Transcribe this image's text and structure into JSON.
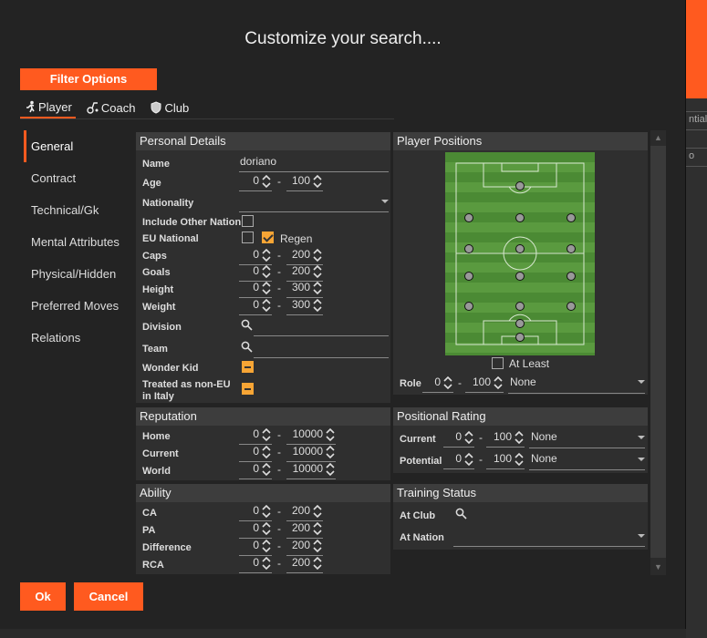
{
  "background": {
    "right_texts": [
      "ntial",
      "o"
    ]
  },
  "dialog": {
    "title": "Customize your search....",
    "filter_options_label": "Filter Options",
    "tabs": [
      {
        "label": "Player",
        "icon": "player-icon"
      },
      {
        "label": "Coach",
        "icon": "coach-icon"
      },
      {
        "label": "Club",
        "icon": "shield-icon"
      }
    ],
    "nav_items": [
      "General",
      "Contract",
      "Technical/Gk",
      "Mental Attributes",
      "Physical/Hidden",
      "Preferred Moves",
      "Relations"
    ],
    "ok_label": "Ok",
    "cancel_label": "Cancel"
  },
  "personal": {
    "heading": "Personal Details",
    "name_label": "Name",
    "name_value": "doriano",
    "age_label": "Age",
    "age_min": "0",
    "age_max": "100",
    "nationality_label": "Nationality",
    "include_other_label": "Include Other Nationa",
    "eu_label": "EU National",
    "regen_label": "Regen",
    "caps_label": "Caps",
    "caps_min": "0",
    "caps_max": "200",
    "goals_label": "Goals",
    "goals_min": "0",
    "goals_max": "200",
    "height_label": "Height",
    "height_min": "0",
    "height_max": "300",
    "weight_label": "Weight",
    "weight_min": "0",
    "weight_max": "300",
    "division_label": "Division",
    "team_label": "Team",
    "wonder_label": "Wonder Kid",
    "noneu_label": "Treated as non-EU in Italy",
    "dash": "-"
  },
  "reputation": {
    "heading": "Reputation",
    "rows": [
      {
        "label": "Home",
        "min": "0",
        "max": "10000"
      },
      {
        "label": "Current",
        "min": "0",
        "max": "10000"
      },
      {
        "label": "World",
        "min": "0",
        "max": "10000"
      }
    ]
  },
  "ability": {
    "heading": "Ability",
    "rows": [
      {
        "label": "CA",
        "min": "0",
        "max": "200"
      },
      {
        "label": "PA",
        "min": "0",
        "max": "200"
      },
      {
        "label": "Difference",
        "min": "0",
        "max": "200"
      },
      {
        "label": "RCA",
        "min": "0",
        "max": "200"
      }
    ]
  },
  "positions": {
    "heading": "Player Positions",
    "at_least_label": "At Least",
    "role_label": "Role",
    "role_min": "0",
    "role_max": "100",
    "role_value": "None"
  },
  "positional_rating": {
    "heading": "Positional Rating",
    "current_label": "Current",
    "current_min": "0",
    "current_max": "100",
    "current_value": "None",
    "potential_label": "Potential",
    "potential_min": "0",
    "potential_max": "100",
    "potential_value": "None"
  },
  "training": {
    "heading": "Training Status",
    "at_club_label": "At Club",
    "at_nation_label": "At Nation"
  },
  "colors": {
    "accent": "#ff5a1f",
    "checkbox_on": "#f7a535",
    "pitch": "#4b8a34"
  }
}
